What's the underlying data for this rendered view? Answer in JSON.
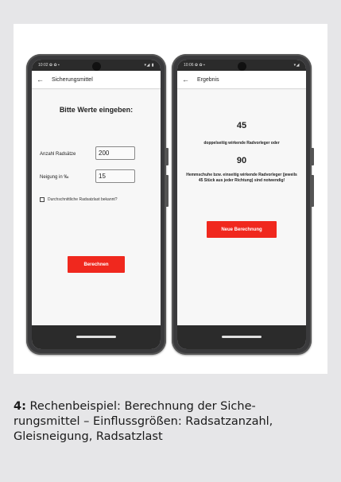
{
  "left_phone": {
    "status_time": "10:02 ✿ ✿ ▪",
    "status_icons": "▾◢ ▮",
    "title": "Sicherungsmittel",
    "heading": "Bitte Werte eingeben:",
    "axles_label": "Anzahl Radsätze",
    "axles_value": "200",
    "slope_label": "Neigung in ‰",
    "slope_value": "15",
    "checkbox_label": "Durchschnittliche Radsatzlast bekannt?",
    "checkbox_checked": false,
    "calculate_button": "Berechnen"
  },
  "right_phone": {
    "status_time": "10:06 ✿ ✿ ▪",
    "status_icons": "▾◢",
    "title": "Ergebnis",
    "result_number_1": "45",
    "result_text_1": "doppelseitig wirkende Radvorleger oder",
    "result_number_2": "90",
    "result_text_2": "Hemmschuhe bzw. einseitig wirkende Radvorleger (jeweils 45 Stück aus jeder Richtung) sind notwendig!",
    "new_calc_button": "Neue Berechnung"
  },
  "caption": {
    "number": "4:",
    "text": " Rechenbeispiel: Berechnung der Siche-\nrungsmittel – Einflussgrößen: Radsatzanzahl,\nGleisneigung, Radsatzlast"
  },
  "colors": {
    "accent_red": "#f0281e",
    "background": "#e6e6e8"
  }
}
